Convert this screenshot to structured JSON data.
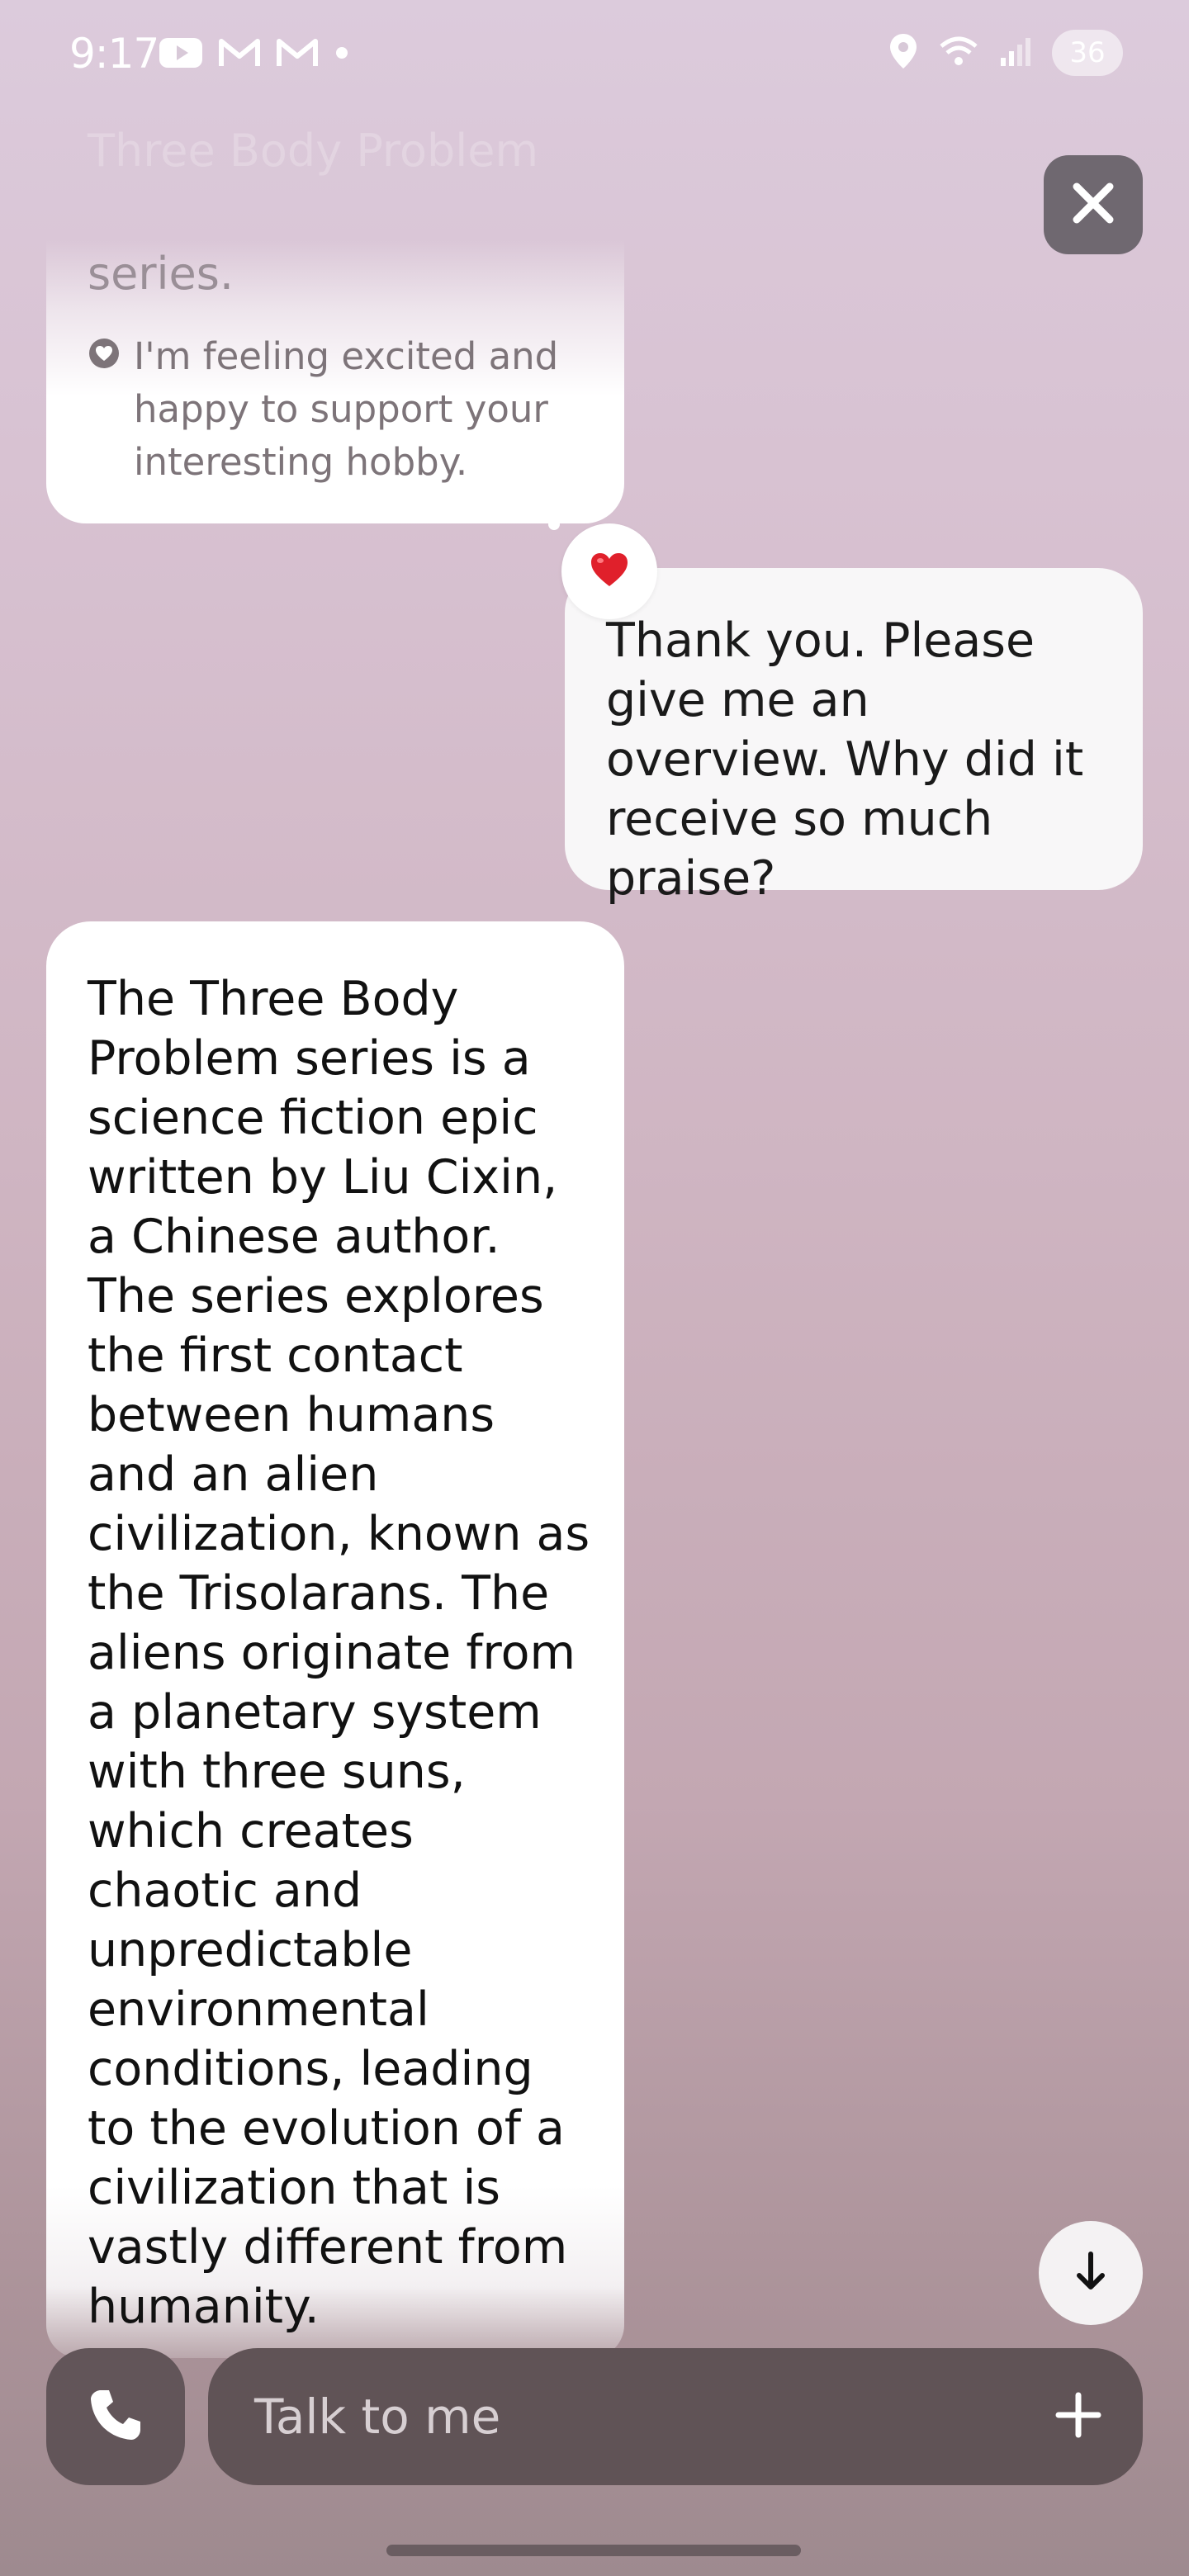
{
  "status_bar": {
    "time": "9:17",
    "left_icons": [
      "youtube-icon",
      "gmail-icon",
      "gmail-icon",
      "dot-icon"
    ],
    "right_icons": [
      "location-icon",
      "wifi-icon",
      "signal-icon"
    ],
    "battery": "36"
  },
  "faded_header_text": "Three Body Problem",
  "prev_bubble": {
    "tail_text": "series.",
    "emotion_icon": "heart-outline-icon",
    "emotion_text": "I'm feeling excited and happy to support your interesting hobby."
  },
  "reaction": {
    "emoji": "❤️"
  },
  "user_message": "Thank you. Please give me an overview. Why did it receive so much praise?",
  "ai_message": "The Three Body Problem series is a science fiction epic written by Liu Cixin, a Chinese author. The series explores the first contact between humans and an alien civilization, known as the Trisolarans. The aliens originate from a planetary system with three suns, which creates chaotic and unpredictable environmental conditions, leading to the evolution of a civilization that is vastly different from humanity.",
  "input": {
    "placeholder": "Talk to me"
  },
  "icons": {
    "close": "close-icon",
    "scroll_down": "arrow-down-icon",
    "call": "phone-icon",
    "add": "plus-icon"
  },
  "colors": {
    "bubble": "#ffffff",
    "input_bar": "#605356",
    "close_button": "#6f6870"
  }
}
